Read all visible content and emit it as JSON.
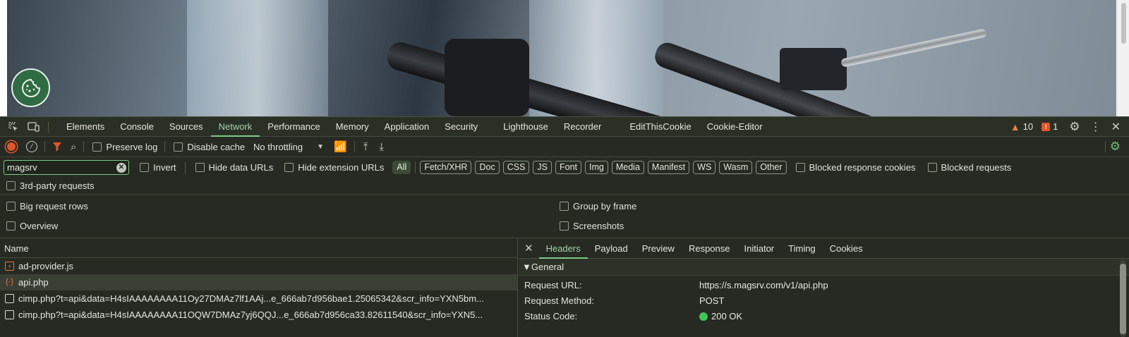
{
  "tabs": [
    "Elements",
    "Console",
    "Sources",
    "Network",
    "Performance",
    "Memory",
    "Application",
    "Security",
    "Lighthouse",
    "Recorder",
    "EditThisCookie",
    "Cookie-Editor"
  ],
  "active_tab": "Network",
  "status": {
    "warnings": "10",
    "issues": "1"
  },
  "toolbar": {
    "preserve_log": "Preserve log",
    "disable_cache": "Disable cache",
    "throttling": "No throttling"
  },
  "filter": {
    "value": "magsrv",
    "invert": "Invert",
    "hide_data_urls": "Hide data URLs",
    "hide_extension_urls": "Hide extension URLs",
    "types": [
      "All",
      "Fetch/XHR",
      "Doc",
      "CSS",
      "JS",
      "Font",
      "Img",
      "Media",
      "Manifest",
      "WS",
      "Wasm",
      "Other"
    ],
    "blocked_response_cookies": "Blocked response cookies",
    "blocked_requests": "Blocked requests",
    "third_party": "3rd-party requests"
  },
  "options": {
    "big_request_rows": "Big request rows",
    "group_by_frame": "Group by frame",
    "overview": "Overview",
    "screenshots": "Screenshots"
  },
  "requests": {
    "header": "Name",
    "rows": [
      {
        "name": "ad-provider.js",
        "type": "script"
      },
      {
        "name": "api.php",
        "type": "xhr"
      },
      {
        "name": "cimp.php?t=api&data=H4sIAAAAAAAA11Oy27DMAz7lf1AAj...e_666ab7d956bae1.25065342&scr_info=YXN5bm...",
        "type": "doc"
      },
      {
        "name": "cimp.php?t=api&data=H4sIAAAAAAAA11OQW7DMAz7yj6QQJ...e_666ab7d956ca33.82611540&scr_info=YXN5...",
        "type": "doc"
      }
    ]
  },
  "details": {
    "tabs": [
      "Headers",
      "Payload",
      "Preview",
      "Response",
      "Initiator",
      "Timing",
      "Cookies"
    ],
    "active_tab": "Headers",
    "section": "▼General",
    "fields": [
      {
        "key": "Request URL:",
        "value": "https://s.magsrv.com/v1/api.php"
      },
      {
        "key": "Request Method:",
        "value": "POST"
      },
      {
        "key": "Status Code:",
        "value": "200 OK"
      }
    ]
  },
  "colors": {
    "accent": "#7cc98a",
    "status_ok": "#3ec35a",
    "warning": "#e8813a",
    "issue": "#e0562a"
  }
}
